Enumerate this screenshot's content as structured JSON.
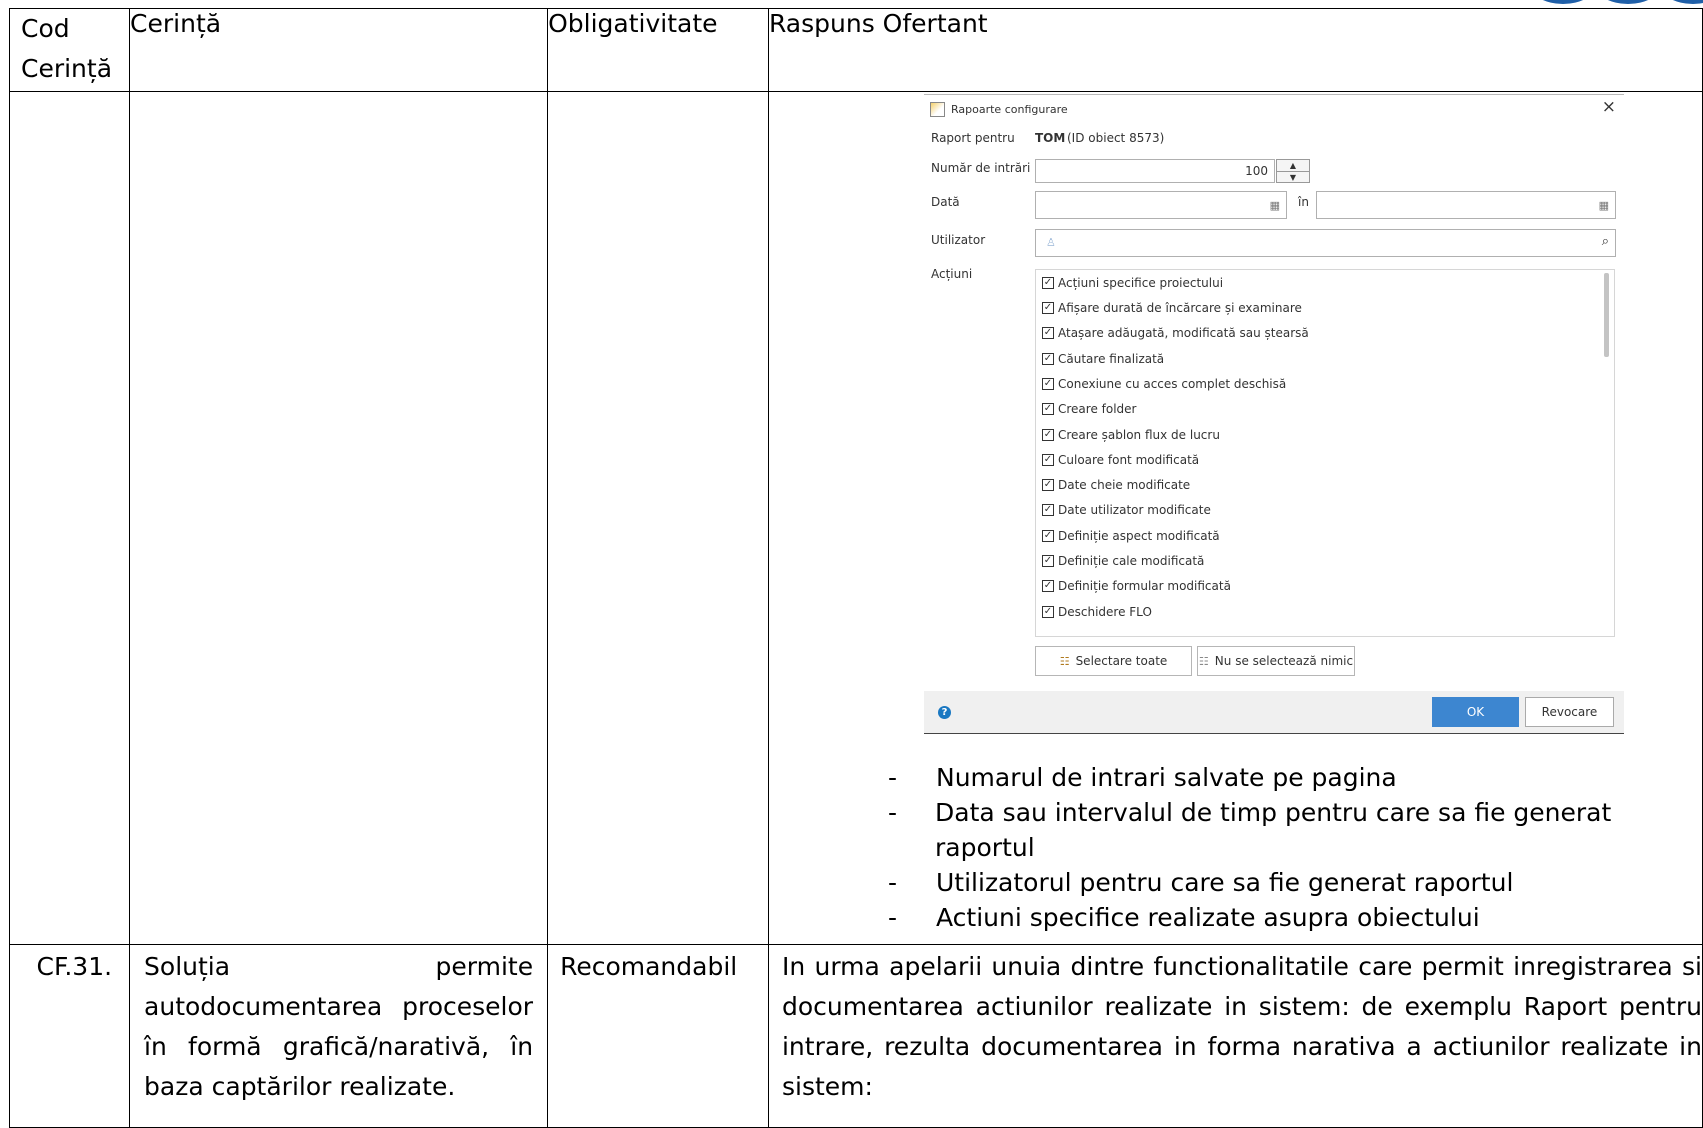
{
  "table": {
    "headers": [
      "Cod Cerință",
      "Cerință",
      "Obligativitate",
      "Raspuns Ofertant"
    ],
    "row_cf31": {
      "code": "CF.31.",
      "requirement": "Soluția permite autodocumentarea proceselor în formă grafică/narativă, în baza captărilor realizate.",
      "obligation": "Recomandabil",
      "response": "In urma apelarii unuia dintre functionalitatile care permit inregistrarea si documentarea actiunilor realizate in sistem: de exemplu Raport pentru intrare, rezulta documentarea in forma narativa a actiunilor realizate in sistem:"
    }
  },
  "dialog": {
    "title": "Rapoarte configurare",
    "report_for_label": "Raport pentru",
    "report_for_name": "TOM",
    "report_for_id": "(ID obiect 8573)",
    "entries_label": "Număr de intrări",
    "entries_value": "100",
    "date_label": "Dată",
    "date_to_label": "în",
    "user_label": "Utilizator",
    "actions_label": "Acțiuni",
    "actions": [
      "Acțiuni specifice proiectului",
      "Afișare durată de încărcare și examinare",
      "Atașare adăugată, modificată sau ștearsă",
      "Căutare finalizată",
      "Conexiune cu acces complet deschisă",
      "Creare folder",
      "Creare șablon flux de lucru",
      "Culoare font modificată",
      "Date cheie modificate",
      "Date utilizator modificate",
      "Definiție aspect modificată",
      "Definiție cale modificată",
      "Definiție formular modificată",
      "Deschidere FLO"
    ],
    "select_all": "Selectare toate",
    "select_none": "Nu se selectează nimic",
    "ok": "OK",
    "cancel": "Revocare"
  },
  "bullets": [
    "Numarul de intrari salvate pe pagina",
    "Data sau intervalul de timp pentru care sa fie generat raportul",
    "Utilizatorul pentru care sa fie generat raportul",
    "Actiuni specifice realizate asupra obiectului"
  ],
  "colors": {
    "ok_button": "#3d86d0",
    "logo": "#1f5fa8"
  }
}
